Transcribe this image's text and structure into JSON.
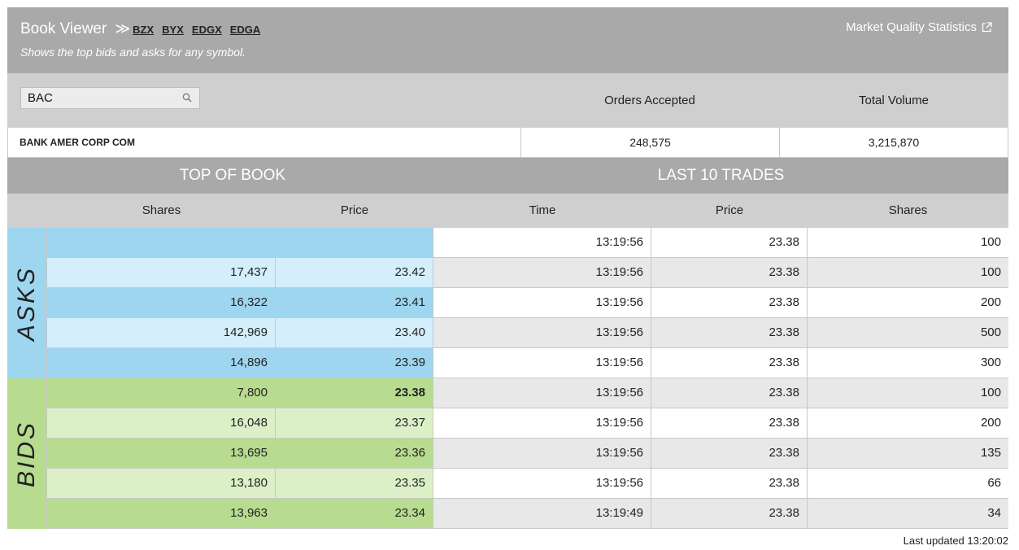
{
  "header": {
    "title": "Book Viewer",
    "chevron": "≫",
    "exchanges": [
      "BZX",
      "BYX",
      "EDGX",
      "EDGA"
    ],
    "subtitle": "Shows the top bids and asks for any symbol.",
    "market_quality_label": "Market Quality Statistics",
    "external_link_icon": "external-link-icon"
  },
  "search": {
    "value": "BAC",
    "icon": "search-icon"
  },
  "stats": {
    "orders_label": "Orders Accepted",
    "volume_label": "Total Volume",
    "company": "BANK AMER CORP COM",
    "orders_value": "248,575",
    "volume_value": "3,215,870"
  },
  "sections": {
    "book": "TOP OF BOOK",
    "trades": "LAST 10 TRADES"
  },
  "columns": {
    "book_shares": "Shares",
    "book_price": "Price",
    "trade_time": "Time",
    "trade_price": "Price",
    "trade_shares": "Shares"
  },
  "side_labels": {
    "asks": "ASKS",
    "bids": "BIDS"
  },
  "asks": [
    {
      "shares": "",
      "price": ""
    },
    {
      "shares": "17,437",
      "price": "23.42"
    },
    {
      "shares": "16,322",
      "price": "23.41"
    },
    {
      "shares": "142,969",
      "price": "23.40"
    },
    {
      "shares": "14,896",
      "price": "23.39"
    }
  ],
  "bids": [
    {
      "shares": "7,800",
      "price": "23.38"
    },
    {
      "shares": "16,048",
      "price": "23.37"
    },
    {
      "shares": "13,695",
      "price": "23.36"
    },
    {
      "shares": "13,180",
      "price": "23.35"
    },
    {
      "shares": "13,963",
      "price": "23.34"
    }
  ],
  "trades": [
    {
      "time": "13:19:56",
      "price": "23.38",
      "shares": "100"
    },
    {
      "time": "13:19:56",
      "price": "23.38",
      "shares": "100"
    },
    {
      "time": "13:19:56",
      "price": "23.38",
      "shares": "200"
    },
    {
      "time": "13:19:56",
      "price": "23.38",
      "shares": "500"
    },
    {
      "time": "13:19:56",
      "price": "23.38",
      "shares": "300"
    },
    {
      "time": "13:19:56",
      "price": "23.38",
      "shares": "100"
    },
    {
      "time": "13:19:56",
      "price": "23.38",
      "shares": "200"
    },
    {
      "time": "13:19:56",
      "price": "23.38",
      "shares": "135"
    },
    {
      "time": "13:19:56",
      "price": "23.38",
      "shares": "66"
    },
    {
      "time": "13:19:49",
      "price": "23.38",
      "shares": "34"
    }
  ],
  "colors": {
    "ask_dark": "#9fd6ef",
    "ask_light": "#d4effb",
    "bid_dark": "#b7db8f",
    "bid_light": "#dcf0c8",
    "trade_even": "#ffffff",
    "trade_odd": "#e8e8e8",
    "header_gray": "#a9a9a9",
    "subheader_gray": "#cfcfcf"
  },
  "footer": {
    "last_updated": "Last updated 13:20:02"
  }
}
